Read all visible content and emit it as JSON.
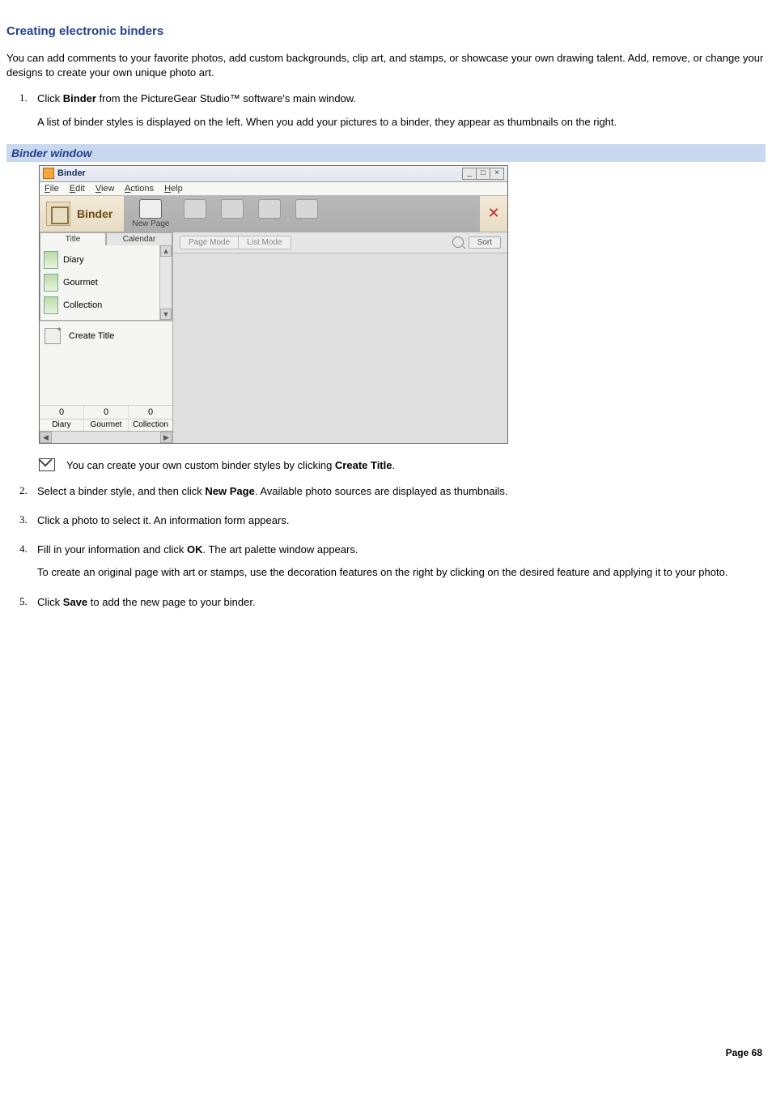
{
  "title": "Creating electronic binders",
  "intro": "You can add comments to your favorite photos, add custom backgrounds, clip art, and stamps, or showcase your own drawing talent. Add, remove, or change your designs to create your own unique photo art.",
  "steps": {
    "s1_pre": "Click ",
    "s1_bold": "Binder",
    "s1_post": " from the PictureGear Studio™ software's main window.",
    "s1_extra": "A list of binder styles is displayed on the left. When you add your pictures to a binder, they appear as thumbnails on the right.",
    "s2_pre": "Select a binder style, and then click ",
    "s2_bold": "New Page",
    "s2_post": ". Available photo sources are displayed as thumbnails.",
    "s3": "Click a photo to select it. An information form appears.",
    "s4_pre": "Fill in your information and click ",
    "s4_bold": "OK",
    "s4_post": ". The art palette window appears.",
    "s4_extra": "To create an original page with art or stamps, use the decoration features on the right by clicking on the desired feature and applying it to your photo.",
    "s5_pre": "Click ",
    "s5_bold": "Save",
    "s5_post": " to add the new page to your binder."
  },
  "caption": "Binder window",
  "window": {
    "title": "Binder",
    "min": "_",
    "max": "□",
    "close": "×",
    "menu": {
      "file": "File",
      "edit": "Edit",
      "view": "View",
      "actions": "Actions",
      "help": "Help"
    },
    "brand": "Binder",
    "prefs_glyph": "✕",
    "tools": {
      "newpage": "New Page",
      "blank": ""
    },
    "tabs": {
      "title": "Title",
      "calendar": "Calendar"
    },
    "styles": {
      "diary": "Diary",
      "gourmet": "Gourmet",
      "collection": "Collection"
    },
    "create_title": "Create Title",
    "counters": {
      "diary": {
        "val": "0",
        "lbl": "Diary"
      },
      "gourmet": {
        "val": "0",
        "lbl": "Gourmet"
      },
      "collection": {
        "val": "0",
        "lbl": "Collection"
      }
    },
    "mode": {
      "page": "Page Mode",
      "list": "List Mode",
      "sort": "Sort"
    }
  },
  "note_pre": "You can create your own custom binder styles by clicking ",
  "note_bold": "Create Title",
  "note_post": ".",
  "footer": "Page 68"
}
